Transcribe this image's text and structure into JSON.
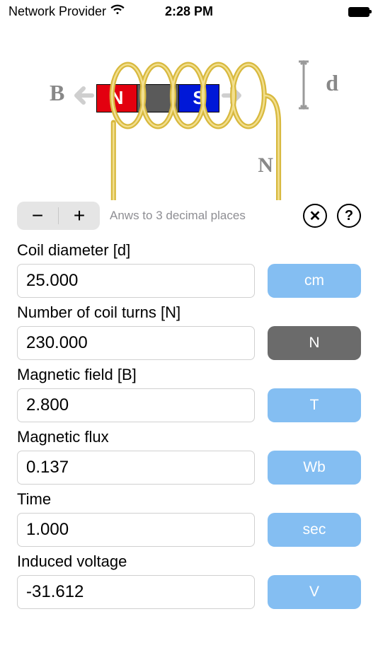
{
  "status": {
    "carrier": "Network Provider",
    "time": "2:28 PM"
  },
  "illustration": {
    "b_label": "B",
    "d_label": "d",
    "n_label": "N",
    "magnet_n": "N",
    "magnet_s": "S"
  },
  "toolbar": {
    "minus": "−",
    "plus": "+",
    "hint": "Anws to 3 decimal places",
    "close": "✕",
    "help": "?"
  },
  "fields": {
    "diameter": {
      "label": "Coil diameter [d]",
      "value": "25.000",
      "unit": "cm",
      "dark": false
    },
    "turns": {
      "label": "Number of coil turns [N]",
      "value": "230.000",
      "unit": "N",
      "dark": true
    },
    "bfield": {
      "label": "Magnetic field [B]",
      "value": "2.800",
      "unit": "T",
      "dark": false
    },
    "flux": {
      "label": "Magnetic flux",
      "value": "0.137",
      "unit": "Wb",
      "dark": false
    },
    "time": {
      "label": "Time",
      "value": "1.000",
      "unit": "sec",
      "dark": false
    },
    "voltage": {
      "label": "Induced voltage",
      "value": "-31.612",
      "unit": "V",
      "dark": false
    }
  },
  "colors": {
    "unit_button": "#84bef2",
    "unit_button_dark": "#6b6b6b",
    "magnet_north": "#e3000f",
    "magnet_south": "#0018d8",
    "coil": "#e8c848"
  }
}
